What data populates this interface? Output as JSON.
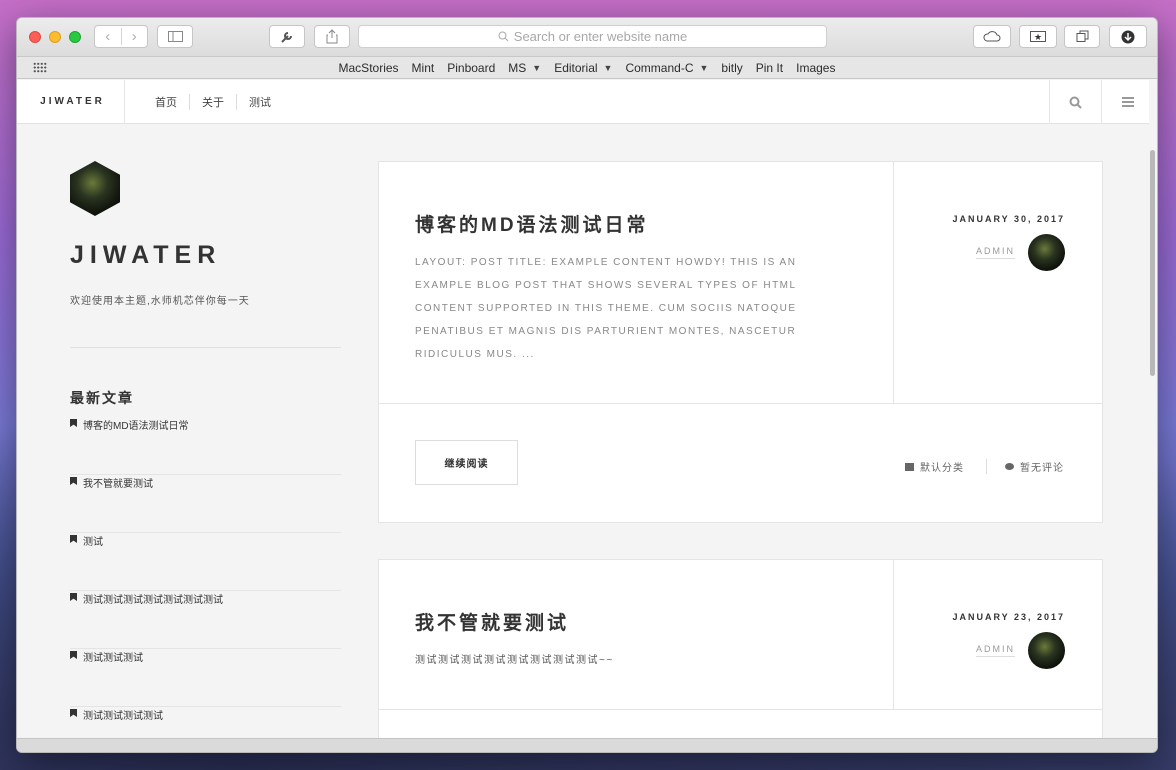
{
  "browser": {
    "address_placeholder": "Search or enter website name",
    "bookmarks": [
      {
        "label": "MacStories"
      },
      {
        "label": "Mint"
      },
      {
        "label": "Pinboard"
      },
      {
        "label": "MS",
        "menu": true
      },
      {
        "label": "Editorial",
        "menu": true
      },
      {
        "label": "Command-C",
        "menu": true
      },
      {
        "label": "bitly"
      },
      {
        "label": "Pin It"
      },
      {
        "label": "Images"
      }
    ]
  },
  "site": {
    "brand": "JIWATER",
    "menu": [
      "首页",
      "关于",
      "测试"
    ],
    "sidebar": {
      "name": "JIWATER",
      "description": "欢迎使用本主题,水师机芯伴你每一天",
      "recent_title": "最新文章",
      "recent": [
        "博客的MD语法测试日常",
        "我不管就要测试",
        "测试",
        "测试测试测试测试测试测试测试",
        "测试测试测试",
        "测试测试测试测试"
      ]
    },
    "posts": [
      {
        "title": "博客的MD语法测试日常",
        "excerpt": "Layout: post title: Example content Howdy! This is an example blog post that shows several types of HTML content supported in this theme. Cum sociis natoque penatibus et magnis dis parturient montes, nascetur ridiculus mus. ...",
        "date": "JANUARY 30, 2017",
        "author": "ADMIN",
        "readmore": "继续阅读",
        "category": "默认分类",
        "comments": "暂无评论"
      },
      {
        "title": "我不管就要测试",
        "excerpt": "测试测试测试测试测试测试测试测试~~",
        "date": "JANUARY 23, 2017",
        "author": "ADMIN"
      }
    ]
  }
}
